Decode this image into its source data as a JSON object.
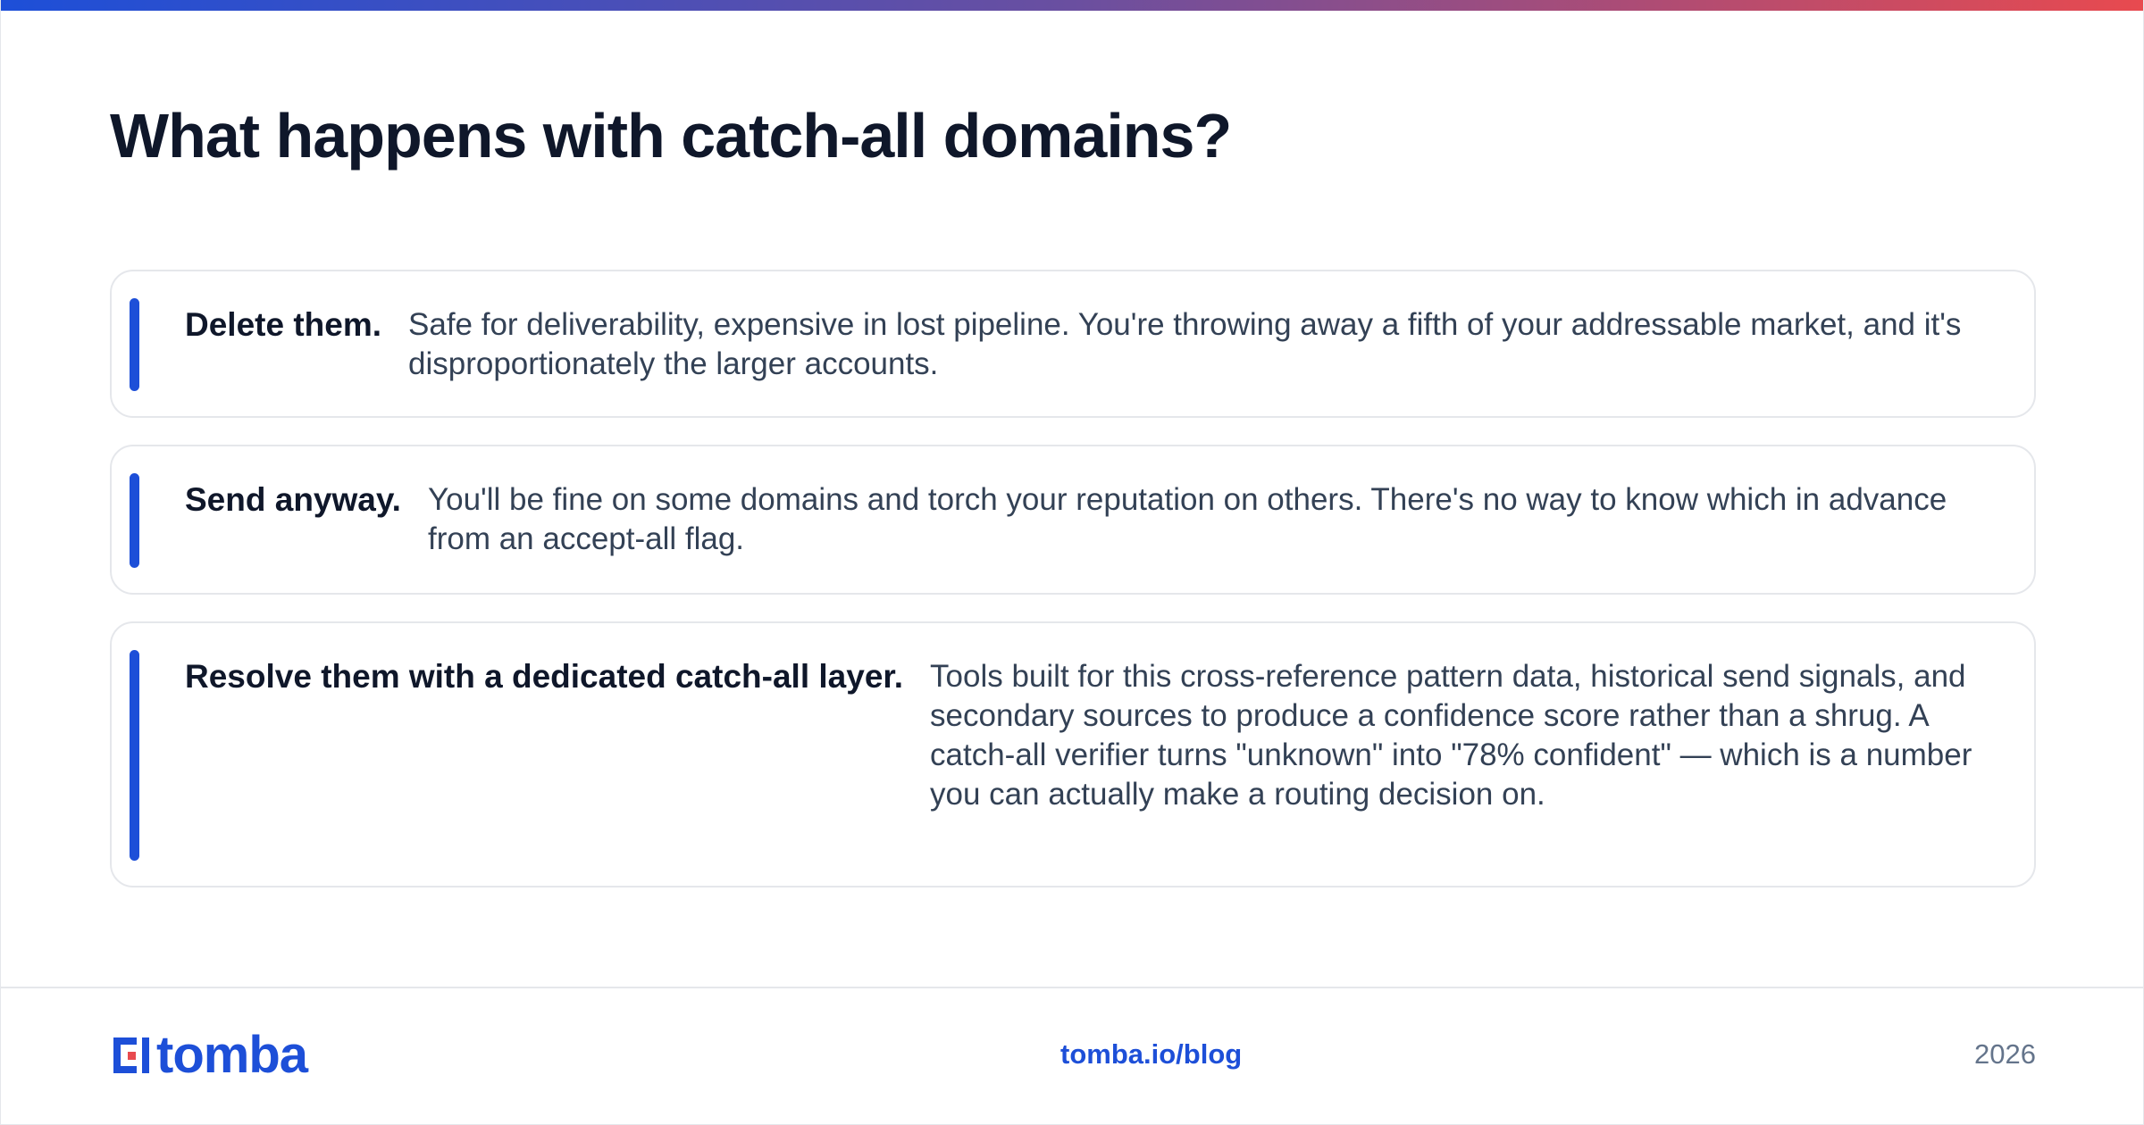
{
  "header": {
    "title": "What happens with catch-all domains?"
  },
  "options": [
    {
      "lead": "Delete them.",
      "body": "Safe for deliverability, expensive in lost pipeline. You're throwing away a fifth of your addressable market, and it's disproportionately the larger accounts."
    },
    {
      "lead": "Send anyway.",
      "body": "You'll be fine on some domains and torch your reputation on others. There's no way to know which in advance from an accept-all flag."
    },
    {
      "lead": "Resolve them with a dedicated catch-all layer.",
      "body": "Tools built for this cross-reference pattern data, historical send signals, and secondary sources to produce a confidence score rather than a shrug. A catch-all verifier turns \"unknown\" into \"78% confident\" — which is a number you can actually make a routing decision on."
    }
  ],
  "footer": {
    "logo_text": "tomba",
    "link": "tomba.io/blog",
    "year": "2026"
  },
  "colors": {
    "accent": "#1d4fd8",
    "gradient_start": "#1d4fd8",
    "gradient_end": "#e84a4f",
    "logo_red": "#e84a4f",
    "title": "#0f172a",
    "body_text": "#334155"
  },
  "icons": {
    "logo_mark": "tomba-logo-icon"
  }
}
